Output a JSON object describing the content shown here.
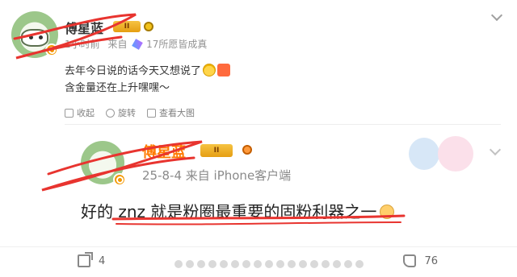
{
  "post": {
    "author_name": "傅星蓝",
    "level_badge": "II",
    "meta": {
      "time": "1小时前",
      "from_label": "来自",
      "source": "17所愿皆成真"
    },
    "content_lines": [
      "去年今日说的话今天又想说了",
      "含金量还在上升嘿嘿～"
    ],
    "actions": [
      {
        "icon": "collapse-icon",
        "label": "收起"
      },
      {
        "icon": "rotate-icon",
        "label": "旋转"
      },
      {
        "icon": "view-image-icon",
        "label": "查看大图"
      }
    ],
    "quoted_screenshot": {
      "author_name": "傅星蓝",
      "level_badge": "II",
      "meta": "25-8-4  来自 iPhone客户端",
      "text": "好的 znz 就是粉圈最重要的固粉利器之一"
    },
    "footer": {
      "share_count": "4",
      "like_count": "76"
    }
  },
  "colors": {
    "accent_orange": "#ff7a00",
    "scribble_red": "#e8342f",
    "muted": "#939393"
  }
}
